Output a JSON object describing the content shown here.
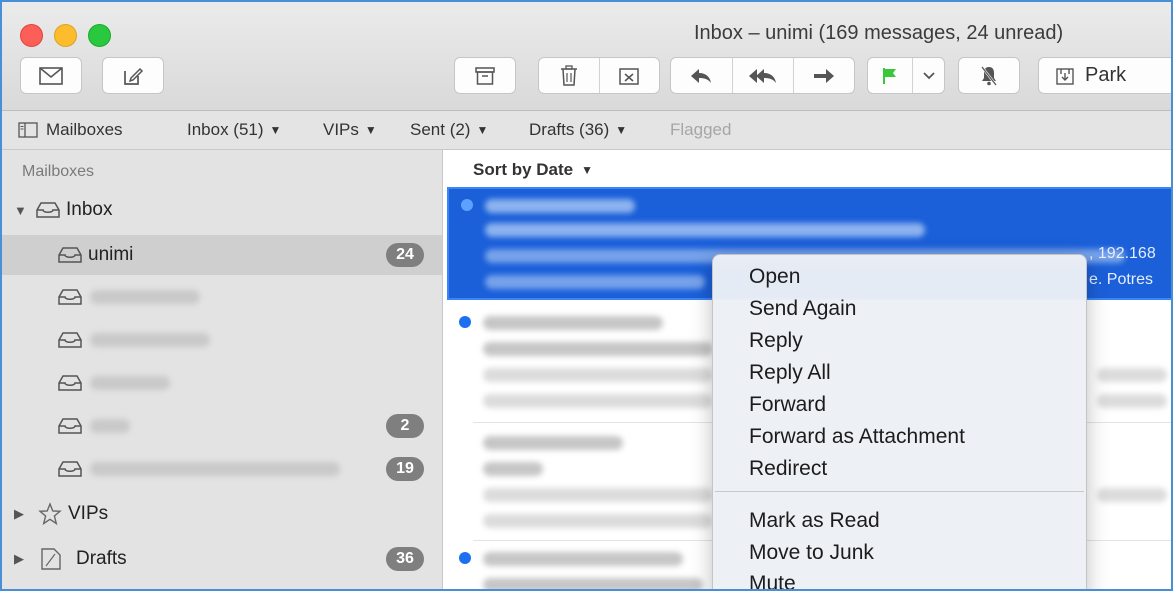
{
  "window": {
    "title": "Inbox – unimi (169 messages, 24 unread)"
  },
  "toolbar": {
    "buttons": [
      "get-mail",
      "compose",
      "archive",
      "delete",
      "junk",
      "reply",
      "reply-all",
      "forward",
      "flag",
      "flag-menu",
      "mute",
      "park"
    ],
    "park_label": "Park",
    "flag_color": "#3ac83a"
  },
  "favorites": {
    "mailboxes": "Mailboxes",
    "inbox": "Inbox (51)",
    "vips": "VIPs",
    "sent": "Sent (2)",
    "drafts": "Drafts (36)",
    "flagged": "Flagged"
  },
  "sidebar": {
    "header": "Mailboxes",
    "inbox_label": "Inbox",
    "unimi_label": "unimi",
    "unimi_badge": "24",
    "account3_badge": "2",
    "account4_badge": "19",
    "vips_label": "VIPs",
    "drafts_label": "Drafts",
    "drafts_badge": "36"
  },
  "message_list": {
    "sort_label": "Sort by Date",
    "visible_fragments": {
      "selected_right_top": ", 192.168",
      "selected_right_bottom": "e. Potres"
    }
  },
  "context_menu": {
    "items": [
      "Open",
      "Send Again",
      "Reply",
      "Reply All",
      "Forward",
      "Forward as Attachment",
      "Redirect",
      "Mark as Read",
      "Move to Junk",
      "Mute"
    ]
  },
  "colors": {
    "selection": "#1b5fd9",
    "unread_dot": "#1d6ff2",
    "window_border": "#4a8fd6"
  }
}
